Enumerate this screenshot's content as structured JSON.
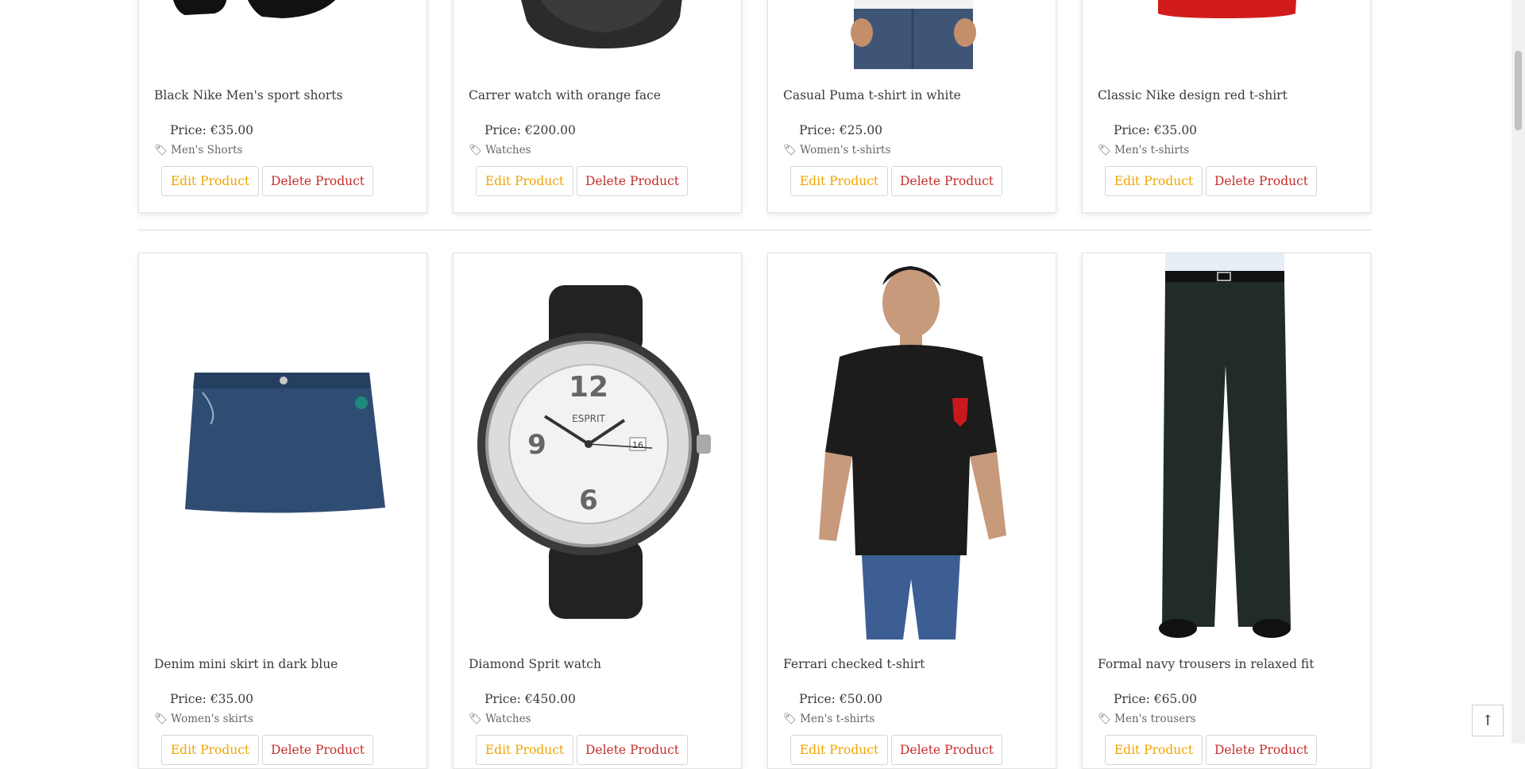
{
  "buttons": {
    "edit_label": "Edit Product",
    "delete_label": "Delete Product"
  },
  "price_prefix": "Price:",
  "products": [
    {
      "title": "Black Nike Men's sport shorts",
      "price": "€35.00",
      "category": "Men's Shorts",
      "image": "black-shorts"
    },
    {
      "title": "Carrer watch with orange face",
      "price": "€200.00",
      "category": "Watches",
      "image": "black-watch"
    },
    {
      "title": "Casual Puma t-shirt in white",
      "price": "€25.00",
      "category": "Women's t-shirts",
      "image": "jeans-person"
    },
    {
      "title": "Classic Nike design red t-shirt",
      "price": "€35.00",
      "category": "Men's t-shirts",
      "image": "red-shirt"
    },
    {
      "title": "Denim mini skirt in dark blue",
      "price": "€35.00",
      "category": "Women's skirts",
      "image": "denim-skirt"
    },
    {
      "title": "Diamond Sprit watch",
      "price": "€450.00",
      "category": "Watches",
      "image": "diamond-watch"
    },
    {
      "title": "Ferrari checked t-shirt",
      "price": "€50.00",
      "category": "Men's t-shirts",
      "image": "black-tshirt-model"
    },
    {
      "title": "Formal navy trousers in relaxed fit",
      "price": "€65.00",
      "category": "Men's trousers",
      "image": "navy-trousers"
    }
  ],
  "watch_brand": "ESPRIT",
  "watch_numerals": [
    "12",
    "9",
    "6"
  ],
  "watch_date": "16",
  "scroll_top_icon": "arrow-up-icon",
  "colors": {
    "edit": "#f0a500",
    "delete": "#c62d2d"
  }
}
